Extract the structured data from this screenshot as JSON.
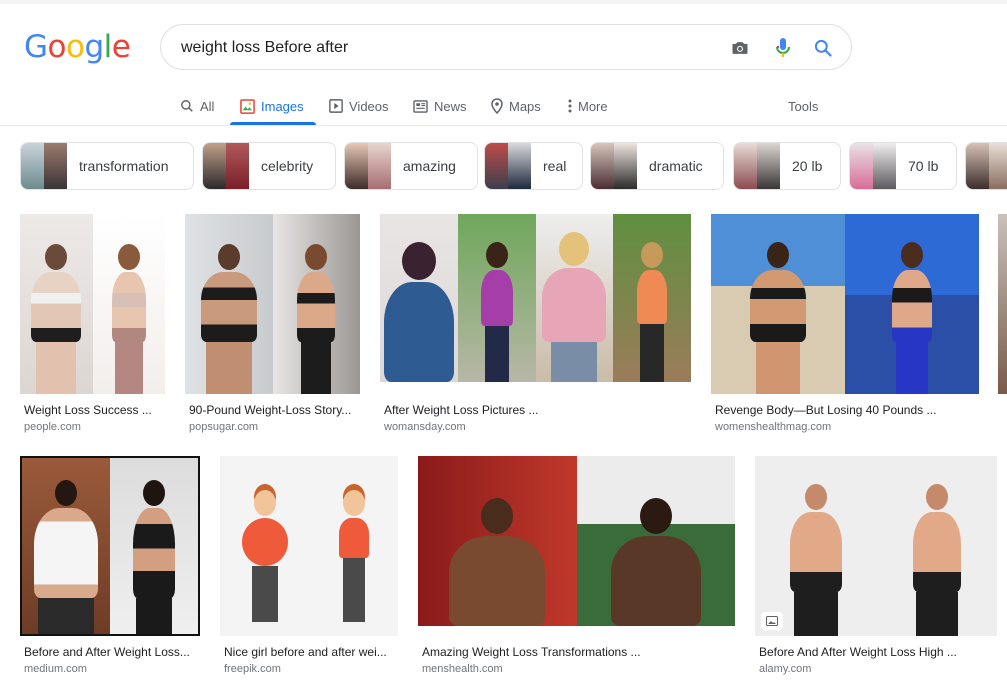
{
  "search": {
    "query": "weight loss Before after"
  },
  "logo": {
    "letters": [
      "G",
      "o",
      "o",
      "g",
      "l",
      "e"
    ],
    "colors": [
      "#4285f4",
      "#ea4335",
      "#fbbc05",
      "#4285f4",
      "#34a853",
      "#ea4335"
    ]
  },
  "tabs": [
    {
      "label": "All",
      "icon": "search-icon"
    },
    {
      "label": "Images",
      "icon": "image-icon",
      "active": true
    },
    {
      "label": "Videos",
      "icon": "video-icon"
    },
    {
      "label": "News",
      "icon": "news-icon"
    },
    {
      "label": "Maps",
      "icon": "map-pin-icon"
    },
    {
      "label": "More",
      "icon": "more-vert-icon"
    }
  ],
  "tools_label": "Tools",
  "chips": [
    {
      "label": "transformation"
    },
    {
      "label": "celebrity"
    },
    {
      "label": "amazing"
    },
    {
      "label": "real"
    },
    {
      "label": "dramatic"
    },
    {
      "label": "20 lb"
    },
    {
      "label": "70 lb"
    }
  ],
  "results": [
    {
      "caption": "Weight Loss Success ...",
      "source": "people.com"
    },
    {
      "caption": "90-Pound Weight-Loss Story...",
      "source": "popsugar.com"
    },
    {
      "caption": "After Weight Loss Pictures ...",
      "source": "womansday.com"
    },
    {
      "caption": "Revenge Body—But Losing 40 Pounds ...",
      "source": "womenshealthmag.com"
    },
    {
      "caption": "Before and After Weight Loss...",
      "source": "medium.com"
    },
    {
      "caption": "Nice girl before and after wei...",
      "source": "freepik.com"
    },
    {
      "caption": "Amazing Weight Loss Transformations ...",
      "source": "menshealth.com"
    },
    {
      "caption": "Before And After Weight Loss High ...",
      "source": "alamy.com"
    }
  ],
  "colors": {
    "accent": "#1a73e8",
    "text_secondary": "#5f6368",
    "source_gray": "#70757a"
  }
}
